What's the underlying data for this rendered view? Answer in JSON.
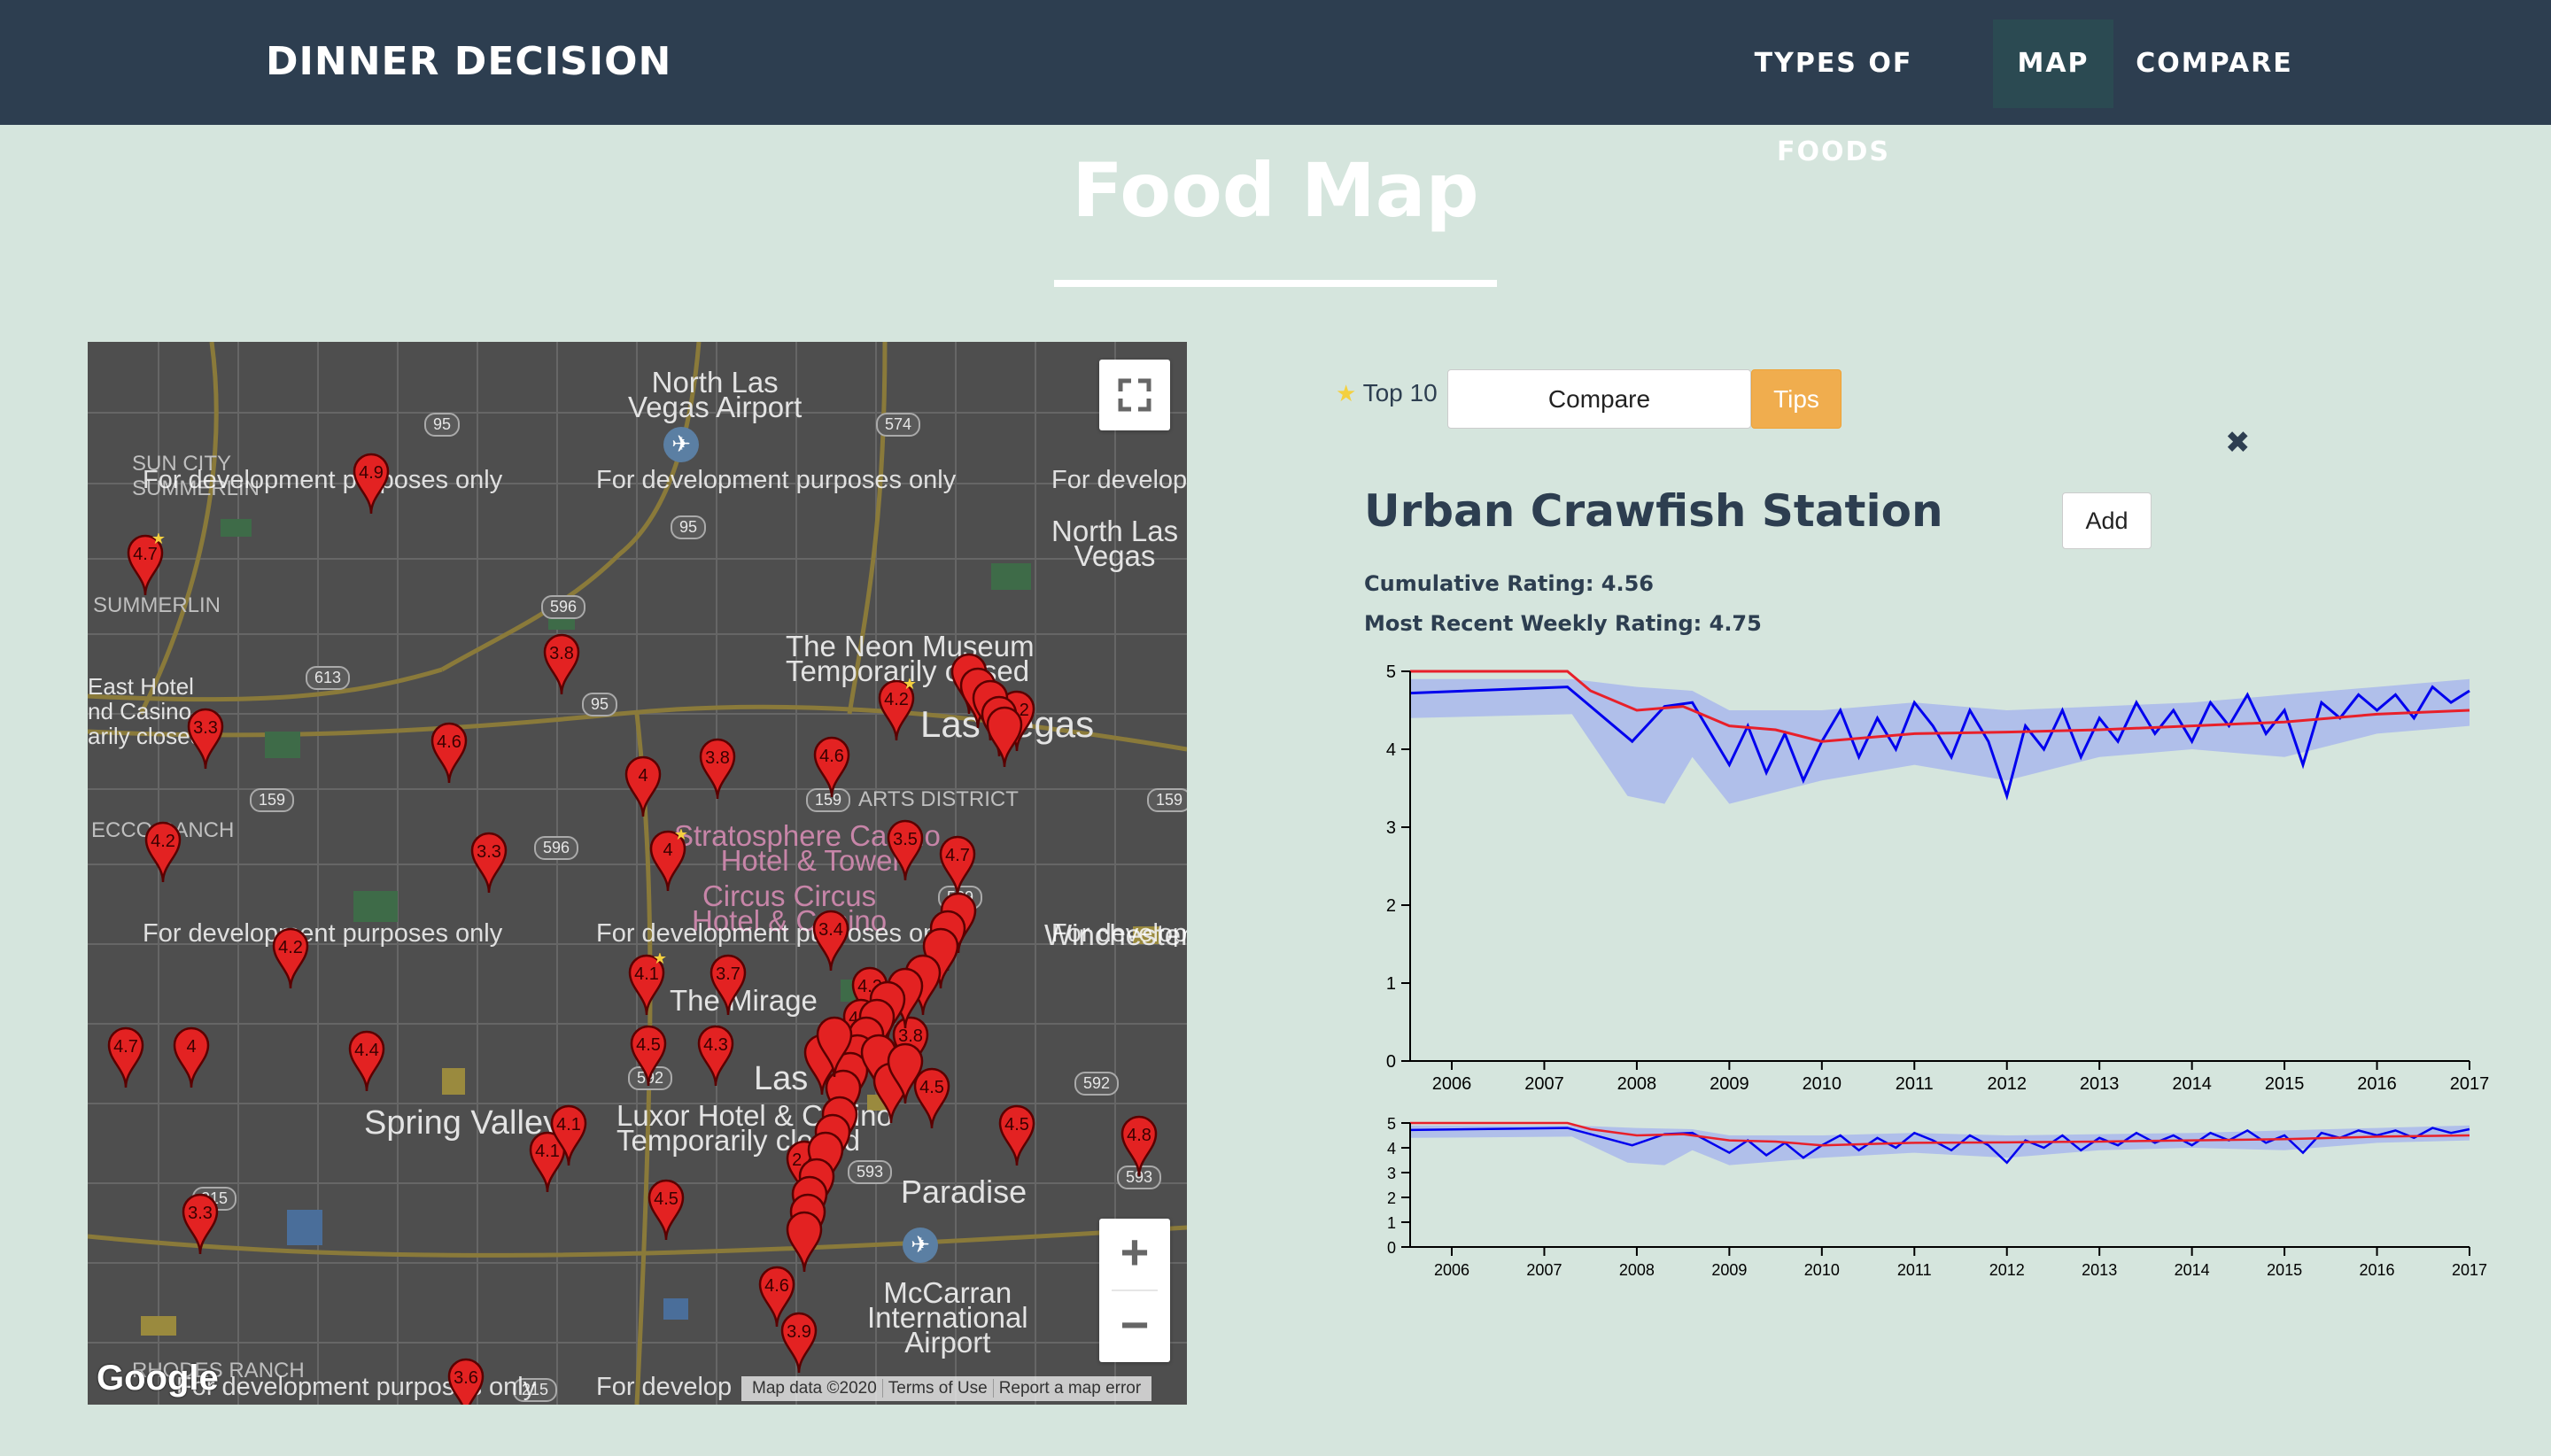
{
  "navbar": {
    "brand": "DINNER DECISION",
    "items": [
      {
        "label": "TYPES OF FOODS",
        "active": false
      },
      {
        "label": "MAP",
        "active": true
      },
      {
        "label": "COMPARE",
        "active": false
      }
    ]
  },
  "page": {
    "title": "Food Map"
  },
  "map": {
    "watermark": "For development purposes only",
    "watermark_cut": "For develop",
    "places": {
      "north_las_vegas_airport": "North Las\nVegas Airport",
      "north_las_vegas": "North Las\nVegas",
      "sun_city": "SUN CITY\nSUMMERLIN",
      "summerlin": "SUMMERLIN",
      "east_hotel": "East Hotel\nnd Casino\narily closed",
      "neon_museum": "The Neon Museum\nTemporarily closed",
      "las_vegas": "Las Vegas",
      "arts_district": "ARTS DISTRICT",
      "rancho": "ECCO RANCH",
      "stratosphere": "Stratosphere Casino,\nHotel & Tower",
      "circus_circus": "Circus Circus\nHotel & Casino",
      "the_mirage": "The Mirage",
      "spring_valley": "Spring Valley",
      "luxor": "Luxor Hotel & Casino\nTemporarily closed",
      "las": "Las",
      "paradise": "Paradise",
      "mccarran": "McCarran\nInternational\nAirport",
      "winchester": "Winchester",
      "rhodes_ranch": "RHODES RANCH"
    },
    "roads": [
      "95",
      "574",
      "95",
      "596",
      "613",
      "95",
      "159",
      "596",
      "159",
      "159",
      "589",
      "592",
      "592",
      "593",
      "593",
      "215",
      "215"
    ],
    "markers": [
      {
        "label": "4.9",
        "star": false
      },
      {
        "label": "4.7",
        "star": true
      },
      {
        "label": "3.8",
        "star": false
      },
      {
        "label": "3.3",
        "star": false
      },
      {
        "label": "4.6",
        "star": false
      },
      {
        "label": "4",
        "star": false
      },
      {
        "label": "3.8",
        "star": false
      },
      {
        "label": "4.6",
        "star": false
      },
      {
        "label": "4.2",
        "star": true
      },
      {
        "label": "4.2",
        "star": false
      },
      {
        "label": "3.3",
        "star": false
      },
      {
        "label": "4",
        "star": true
      },
      {
        "label": "3.5",
        "star": false
      },
      {
        "label": "4.7",
        "star": false
      },
      {
        "label": "4.2",
        "star": false
      },
      {
        "label": "4.7",
        "star": false
      },
      {
        "label": "4",
        "star": false
      },
      {
        "label": "4.4",
        "star": false
      },
      {
        "label": "4.1",
        "star": true
      },
      {
        "label": "3.7",
        "star": false
      },
      {
        "label": "4.5",
        "star": false
      },
      {
        "label": "4.3",
        "star": false
      },
      {
        "label": "4.2",
        "star": false
      },
      {
        "label": "4.5",
        "star": false
      },
      {
        "label": "3.3",
        "star": false
      },
      {
        "label": "4.1",
        "star": true
      },
      {
        "label": "4.5",
        "star": false
      },
      {
        "label": "4.1",
        "star": false
      },
      {
        "label": "4.5",
        "star": false
      },
      {
        "label": "4.8",
        "star": false
      },
      {
        "label": "3.4",
        "star": false
      },
      {
        "label": "4.1",
        "star": false
      },
      {
        "label": "2.4",
        "star": false
      },
      {
        "label": "3.8",
        "star": false
      },
      {
        "label": "3.2",
        "star": false
      },
      {
        "label": "4.6",
        "star": false
      },
      {
        "label": "3.9",
        "star": false
      },
      {
        "label": "3.6",
        "star": false
      }
    ],
    "google": "Google",
    "attribution": [
      "Map data ©2020",
      "Terms of Use",
      "Report a map error"
    ],
    "zoom_in": "+",
    "zoom_out": "−"
  },
  "panel": {
    "top10_label": "Top 10",
    "compare_button": "Compare",
    "tips_button": "Tips",
    "close_icon": "✖",
    "restaurant_name": "Urban Crawfish Station",
    "add_button": "Add",
    "cumulative_rating": "Cumulative Rating: 4.56",
    "weekly_rating": "Most Recent Weekly Rating: 4.75"
  },
  "colors": {
    "navbar": "#2d3e50",
    "background": "#d5e5dd",
    "weekly_line": "#0000ee",
    "cumulative_line": "#e8202a",
    "band": "#a9b9ec",
    "tips": "#f0ad4e"
  },
  "chart_data": [
    {
      "type": "line",
      "x_ticks": [
        "2006",
        "2007",
        "2008",
        "2009",
        "2010",
        "2011",
        "2012",
        "2013",
        "2014",
        "2015",
        "2016",
        "2017"
      ],
      "y_ticks": [
        "0",
        "1",
        "2",
        "3",
        "4",
        "5"
      ],
      "xlim": [
        2005.55,
        2017.0
      ],
      "ylim": [
        0,
        5
      ],
      "series": [
        {
          "role": "weekly",
          "values": [
            [
              2005.55,
              4.72
            ],
            [
              2007.25,
              4.8
            ],
            [
              2007.7,
              4.35
            ],
            [
              2007.95,
              4.1
            ],
            [
              2008.3,
              4.55
            ],
            [
              2008.6,
              4.6
            ],
            [
              2008.8,
              4.2
            ],
            [
              2009.0,
              3.8
            ],
            [
              2009.2,
              4.3
            ],
            [
              2009.4,
              3.7
            ],
            [
              2009.6,
              4.2
            ],
            [
              2009.8,
              3.6
            ],
            [
              2010.0,
              4.1
            ],
            [
              2010.2,
              4.5
            ],
            [
              2010.4,
              3.9
            ],
            [
              2010.6,
              4.4
            ],
            [
              2010.8,
              4.0
            ],
            [
              2011.0,
              4.6
            ],
            [
              2011.2,
              4.3
            ],
            [
              2011.4,
              3.9
            ],
            [
              2011.6,
              4.5
            ],
            [
              2011.8,
              4.1
            ],
            [
              2012.0,
              3.4
            ],
            [
              2012.2,
              4.3
            ],
            [
              2012.4,
              4.0
            ],
            [
              2012.6,
              4.5
            ],
            [
              2012.8,
              3.9
            ],
            [
              2013.0,
              4.4
            ],
            [
              2013.2,
              4.1
            ],
            [
              2013.4,
              4.6
            ],
            [
              2013.6,
              4.2
            ],
            [
              2013.8,
              4.5
            ],
            [
              2014.0,
              4.1
            ],
            [
              2014.2,
              4.6
            ],
            [
              2014.4,
              4.3
            ],
            [
              2014.6,
              4.7
            ],
            [
              2014.8,
              4.2
            ],
            [
              2015.0,
              4.5
            ],
            [
              2015.2,
              3.8
            ],
            [
              2015.4,
              4.6
            ],
            [
              2015.6,
              4.4
            ],
            [
              2015.8,
              4.7
            ],
            [
              2016.0,
              4.5
            ],
            [
              2016.2,
              4.7
            ],
            [
              2016.4,
              4.4
            ],
            [
              2016.6,
              4.8
            ],
            [
              2016.8,
              4.6
            ],
            [
              2017.0,
              4.75
            ]
          ]
        },
        {
          "role": "cumulative",
          "values": [
            [
              2005.55,
              5.0
            ],
            [
              2007.25,
              5.0
            ],
            [
              2007.5,
              4.75
            ],
            [
              2008.0,
              4.5
            ],
            [
              2008.5,
              4.55
            ],
            [
              2009.0,
              4.3
            ],
            [
              2009.5,
              4.25
            ],
            [
              2010.0,
              4.1
            ],
            [
              2010.5,
              4.15
            ],
            [
              2011.0,
              4.2
            ],
            [
              2012.0,
              4.22
            ],
            [
              2013.0,
              4.25
            ],
            [
              2014.0,
              4.3
            ],
            [
              2015.0,
              4.35
            ],
            [
              2016.0,
              4.45
            ],
            [
              2017.0,
              4.5
            ]
          ]
        },
        {
          "role": "band",
          "upper": [
            [
              2005.55,
              4.9
            ],
            [
              2007.3,
              4.9
            ],
            [
              2008.0,
              4.8
            ],
            [
              2008.6,
              4.75
            ],
            [
              2009.0,
              4.5
            ],
            [
              2010.0,
              4.5
            ],
            [
              2011.0,
              4.6
            ],
            [
              2012.0,
              4.5
            ],
            [
              2013.0,
              4.55
            ],
            [
              2014.0,
              4.6
            ],
            [
              2015.0,
              4.7
            ],
            [
              2016.0,
              4.8
            ],
            [
              2017.0,
              4.9
            ]
          ],
          "lower": [
            [
              2005.55,
              4.4
            ],
            [
              2007.3,
              4.45
            ],
            [
              2007.9,
              3.4
            ],
            [
              2008.3,
              3.3
            ],
            [
              2008.6,
              3.9
            ],
            [
              2009.0,
              3.3
            ],
            [
              2010.0,
              3.6
            ],
            [
              2011.0,
              3.8
            ],
            [
              2012.0,
              3.6
            ],
            [
              2013.0,
              3.9
            ],
            [
              2014.0,
              4.0
            ],
            [
              2015.0,
              3.9
            ],
            [
              2016.0,
              4.2
            ],
            [
              2017.0,
              4.3
            ]
          ]
        }
      ]
    },
    {
      "type": "line",
      "x_ticks": [
        "2006",
        "2007",
        "2008",
        "2009",
        "2010",
        "2011",
        "2012",
        "2013",
        "2014",
        "2015",
        "2016",
        "2017"
      ],
      "y_ticks": [
        "0",
        "1",
        "2",
        "3",
        "4",
        "5"
      ],
      "xlim": [
        2005.55,
        2017.0
      ],
      "ylim": [
        0,
        5
      ],
      "role": "overview"
    }
  ]
}
